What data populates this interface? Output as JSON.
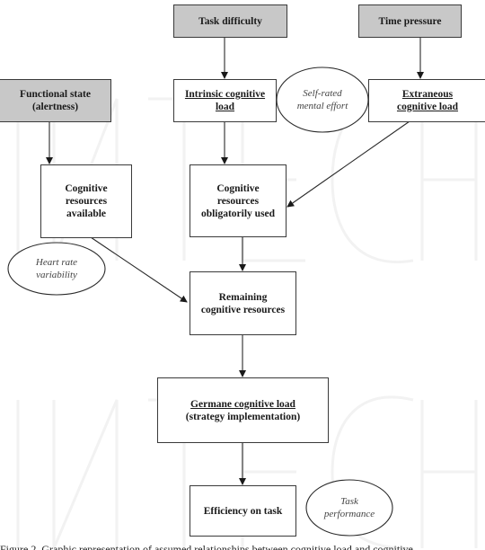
{
  "diagram": {
    "type": "flowchart",
    "nodes": {
      "task_difficulty": {
        "label": "Task difficulty",
        "style": "shaded"
      },
      "time_pressure": {
        "label": "Time pressure",
        "style": "shaded"
      },
      "functional_state": {
        "line1": "Functional state",
        "line2": "(alertness)",
        "style": "shaded"
      },
      "intrinsic_load": {
        "line1": "Intrinsic cognitive",
        "line2": "load",
        "underlined": true
      },
      "extraneous_load": {
        "line1": "Extraneous",
        "line2": "cognitive load",
        "underlined": true
      },
      "resources_available": {
        "line1": "Cognitive",
        "line2": "resources",
        "line3": "available"
      },
      "resources_used": {
        "line1": "Cognitive",
        "line2": "resources",
        "line3": "obligatorily used"
      },
      "remaining_resources": {
        "line1": "Remaining",
        "line2": "cognitive resources"
      },
      "germane_load": {
        "line1": "Germane cognitive load",
        "line2": "(strategy implementation)"
      },
      "efficiency": {
        "label": "Efficiency on task"
      }
    },
    "measures": {
      "self_rated_effort": {
        "line1": "Self-rated",
        "line2": "mental effort"
      },
      "heart_rate_variability": {
        "line1": "Heart rate",
        "line2": "variability"
      },
      "task_performance": {
        "line1": "Task",
        "line2": "performance"
      }
    },
    "edges": [
      {
        "from": "Task difficulty",
        "to": "Intrinsic cognitive load"
      },
      {
        "from": "Time pressure",
        "to": "Extraneous cognitive load"
      },
      {
        "from": "Functional state (alertness)",
        "to": "Cognitive resources available"
      },
      {
        "from": "Intrinsic cognitive load",
        "to": "Cognitive resources obligatorily used"
      },
      {
        "from": "Extraneous cognitive load",
        "to": "Cognitive resources obligatorily used"
      },
      {
        "from": "Cognitive resources available",
        "to": "Remaining cognitive resources"
      },
      {
        "from": "Cognitive resources obligatorily used",
        "to": "Remaining cognitive resources"
      },
      {
        "from": "Remaining cognitive resources",
        "to": "Germane cognitive load (strategy implementation)"
      },
      {
        "from": "Germane cognitive load (strategy implementation)",
        "to": "Efficiency on task"
      }
    ],
    "watermark": "INTECH",
    "caption_partial": "Figure 2. Graphic representation of assumed relationships between cognitive load and cognitive"
  }
}
